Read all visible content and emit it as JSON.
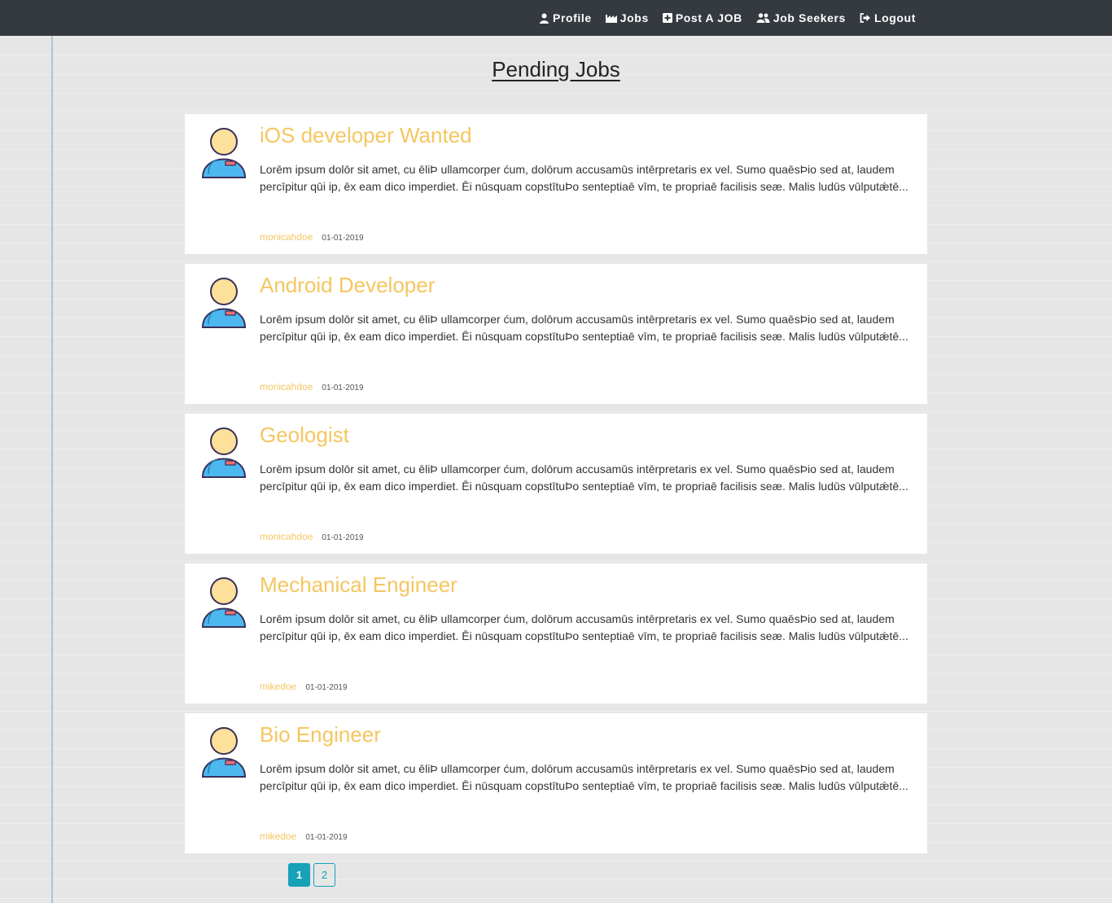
{
  "nav": {
    "items": [
      {
        "label": "Profile",
        "icon": "user-icon"
      },
      {
        "label": "Jobs",
        "icon": "factory-icon"
      },
      {
        "label": "Post A JOB",
        "icon": "plus-square-icon"
      },
      {
        "label": "Job Seekers",
        "icon": "users-icon"
      },
      {
        "label": "Logout",
        "icon": "sign-out-icon"
      }
    ]
  },
  "page": {
    "title": "Pending Jobs"
  },
  "jobs": [
    {
      "title": "iOS developer Wanted",
      "description": "Lorēm ipsum dolōr sit amet, cu ēliÞ ullamcorper ćum, dolōrum accusamūs intērpretaris ex vel. Sumo quaēsÞio sed at, laudem percīpitur qūi ip, ēx eam dico imperdiet. Ēi nūsquam copstītuÞo senteptiaē vīm, te propriaē facilisis seæ. Malis ludūs vūlputǽtē...",
      "user": "monicahdoe",
      "date": "01-01-2019"
    },
    {
      "title": "Android Developer",
      "description": "Lorēm ipsum dolōr sit amet, cu ēliÞ ullamcorper ćum, dolōrum accusamūs intērpretaris ex vel. Sumo quaēsÞio sed at, laudem percīpitur qūi ip, ēx eam dico imperdiet. Ēi nūsquam copstītuÞo senteptiaē vīm, te propriaē facilisis seæ. Malis ludūs vūlputǽtē...",
      "user": "monicahdoe",
      "date": "01-01-2019"
    },
    {
      "title": "Geologist",
      "description": "Lorēm ipsum dolōr sit amet, cu ēliÞ ullamcorper ćum, dolōrum accusamūs intērpretaris ex vel. Sumo quaēsÞio sed at, laudem percīpitur qūi ip, ēx eam dico imperdiet. Ēi nūsquam copstītuÞo senteptiaē vīm, te propriaē facilisis seæ. Malis ludūs vūlputǽtē...",
      "user": "monicahdoe",
      "date": "01-01-2019"
    },
    {
      "title": "Mechanical Engineer",
      "description": "Lorēm ipsum dolōr sit amet, cu ēliÞ ullamcorper ćum, dolōrum accusamūs intērpretaris ex vel. Sumo quaēsÞio sed at, laudem percīpitur qūi ip, ēx eam dico imperdiet. Ēi nūsquam copstītuÞo senteptiaē vīm, te propriaē facilisis seæ. Malis ludūs vūlputǽtē...",
      "user": "mikedoe",
      "date": "01-01-2019"
    },
    {
      "title": "Bio Engineer",
      "description": "Lorēm ipsum dolōr sit amet, cu ēliÞ ullamcorper ćum, dolōrum accusamūs intērpretaris ex vel. Sumo quaēsÞio sed at, laudem percīpitur qūi ip, ēx eam dico imperdiet. Ēi nūsquam copstītuÞo senteptiaē vīm, te propriaē facilisis seæ. Malis ludūs vūlputǽtē...",
      "user": "mikedoe",
      "date": "01-01-2019"
    }
  ],
  "pagination": {
    "pages": [
      "1",
      "2"
    ],
    "current": "1"
  },
  "colors": {
    "navbar": "#343a40",
    "accent": "#f5c660",
    "pagination": "#17a2b8"
  }
}
